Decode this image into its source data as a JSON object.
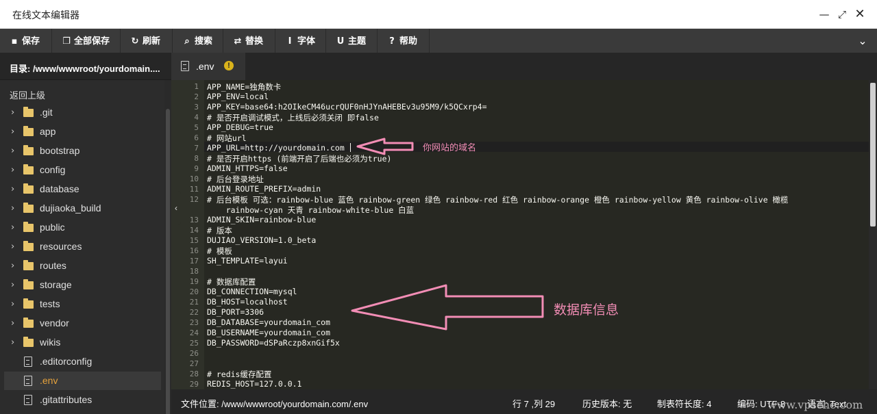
{
  "window": {
    "title": "在线文本编辑器",
    "min_icon": "minimize-icon",
    "max_icon": "maximize-icon",
    "close_icon": "close-icon"
  },
  "toolbar": {
    "buttons": [
      {
        "label": "保存",
        "icon": "save-icon",
        "glyph": "▪"
      },
      {
        "label": "全部保存",
        "icon": "save-all-icon",
        "glyph": "❐"
      },
      {
        "label": "刷新",
        "icon": "refresh-icon",
        "glyph": "↻"
      },
      {
        "label": "搜索",
        "icon": "search-icon",
        "glyph": "⌕"
      },
      {
        "label": "替换",
        "icon": "replace-icon",
        "glyph": "⇄"
      },
      {
        "label": "字体",
        "icon": "font-icon",
        "glyph": "I"
      },
      {
        "label": "主题",
        "icon": "theme-icon",
        "glyph": "U"
      },
      {
        "label": "帮助",
        "icon": "help-icon",
        "glyph": "?"
      }
    ],
    "collapse_icon": "chevron-down-icon"
  },
  "sidebar": {
    "directory": "目录: /www/wwwroot/yourdomain....",
    "back_label": "返回上级",
    "items": [
      {
        "type": "folder",
        "name": ".git"
      },
      {
        "type": "folder",
        "name": "app"
      },
      {
        "type": "folder",
        "name": "bootstrap"
      },
      {
        "type": "folder",
        "name": "config"
      },
      {
        "type": "folder",
        "name": "database"
      },
      {
        "type": "folder",
        "name": "dujiaoka_build"
      },
      {
        "type": "folder",
        "name": "public"
      },
      {
        "type": "folder",
        "name": "resources"
      },
      {
        "type": "folder",
        "name": "routes"
      },
      {
        "type": "folder",
        "name": "storage"
      },
      {
        "type": "folder",
        "name": "tests"
      },
      {
        "type": "folder",
        "name": "vendor"
      },
      {
        "type": "folder",
        "name": "wikis"
      },
      {
        "type": "file",
        "name": ".editorconfig"
      },
      {
        "type": "file",
        "name": ".env",
        "active": true
      },
      {
        "type": "file",
        "name": ".gitattributes"
      }
    ]
  },
  "tab": {
    "name": ".env",
    "warning_glyph": "!",
    "icon": "file-icon"
  },
  "editor": {
    "active_line": 7,
    "lines": [
      {
        "n": "1",
        "text": "APP_NAME=独角数卡"
      },
      {
        "n": "2",
        "text": "APP_ENV=local"
      },
      {
        "n": "3",
        "text": "APP_KEY=base64:h2OIkeCM46ucrQUF0nHJYnAHEBEv3u95M9/k5QCxrp4="
      },
      {
        "n": "4",
        "text": "# 是否开启调试模式，上线后必须关闭 即false"
      },
      {
        "n": "5",
        "text": "APP_DEBUG=true"
      },
      {
        "n": "6",
        "text": "# 网站url"
      },
      {
        "n": "7",
        "text": "APP_URL=http://yourdomain.com"
      },
      {
        "n": "8",
        "text": "# 是否开启https (前端开启了后端也必须为true)"
      },
      {
        "n": "9",
        "text": "ADMIN_HTTPS=false"
      },
      {
        "n": "10",
        "text": "# 后台登录地址"
      },
      {
        "n": "11",
        "text": "ADMIN_ROUTE_PREFIX=admin"
      },
      {
        "n": "12",
        "text": "# 后台模板 可选：rainbow-blue 蓝色 rainbow-green 绿色 rainbow-red 红色 rainbow-orange 橙色 rainbow-yellow 黄色 rainbow-olive 橄榄"
      },
      {
        "n": "",
        "text": "    rainbow-cyan 天青 rainbow-white-blue 白蓝"
      },
      {
        "n": "13",
        "text": "ADMIN_SKIN=rainbow-blue"
      },
      {
        "n": "14",
        "text": "# 版本"
      },
      {
        "n": "15",
        "text": "DUJIAO_VERSION=1.0_beta"
      },
      {
        "n": "16",
        "text": "# 模板"
      },
      {
        "n": "17",
        "text": "SH_TEMPLATE=layui"
      },
      {
        "n": "18",
        "text": ""
      },
      {
        "n": "19",
        "text": "# 数据库配置"
      },
      {
        "n": "20",
        "text": "DB_CONNECTION=mysql"
      },
      {
        "n": "21",
        "text": "DB_HOST=localhost"
      },
      {
        "n": "22",
        "text": "DB_PORT=3306"
      },
      {
        "n": "23",
        "text": "DB_DATABASE=yourdomain_com"
      },
      {
        "n": "24",
        "text": "DB_USERNAME=yourdomain_com"
      },
      {
        "n": "25",
        "text": "DB_PASSWORD=dSPaRczp8xnGif5x"
      },
      {
        "n": "26",
        "text": ""
      },
      {
        "n": "27",
        "text": ""
      },
      {
        "n": "28",
        "text": "# redis缓存配置"
      },
      {
        "n": "29",
        "text": "REDIS_HOST=127.0.0.1"
      }
    ],
    "fold_glyph": "‹"
  },
  "annotations": {
    "domain_note": "你网站的域名",
    "db_note": "数据库信息",
    "color": "#f28db5"
  },
  "status": {
    "file_path": "文件位置: /www/wwwroot/yourdomain.com/.env",
    "cursor": "行 7 ,列 29",
    "history": "历史版本: 无",
    "tab_size": "制表符长度: 4",
    "encoding": "编码: UTF-8",
    "language": "语言: Text"
  },
  "watermark": "www.vpsche.com"
}
